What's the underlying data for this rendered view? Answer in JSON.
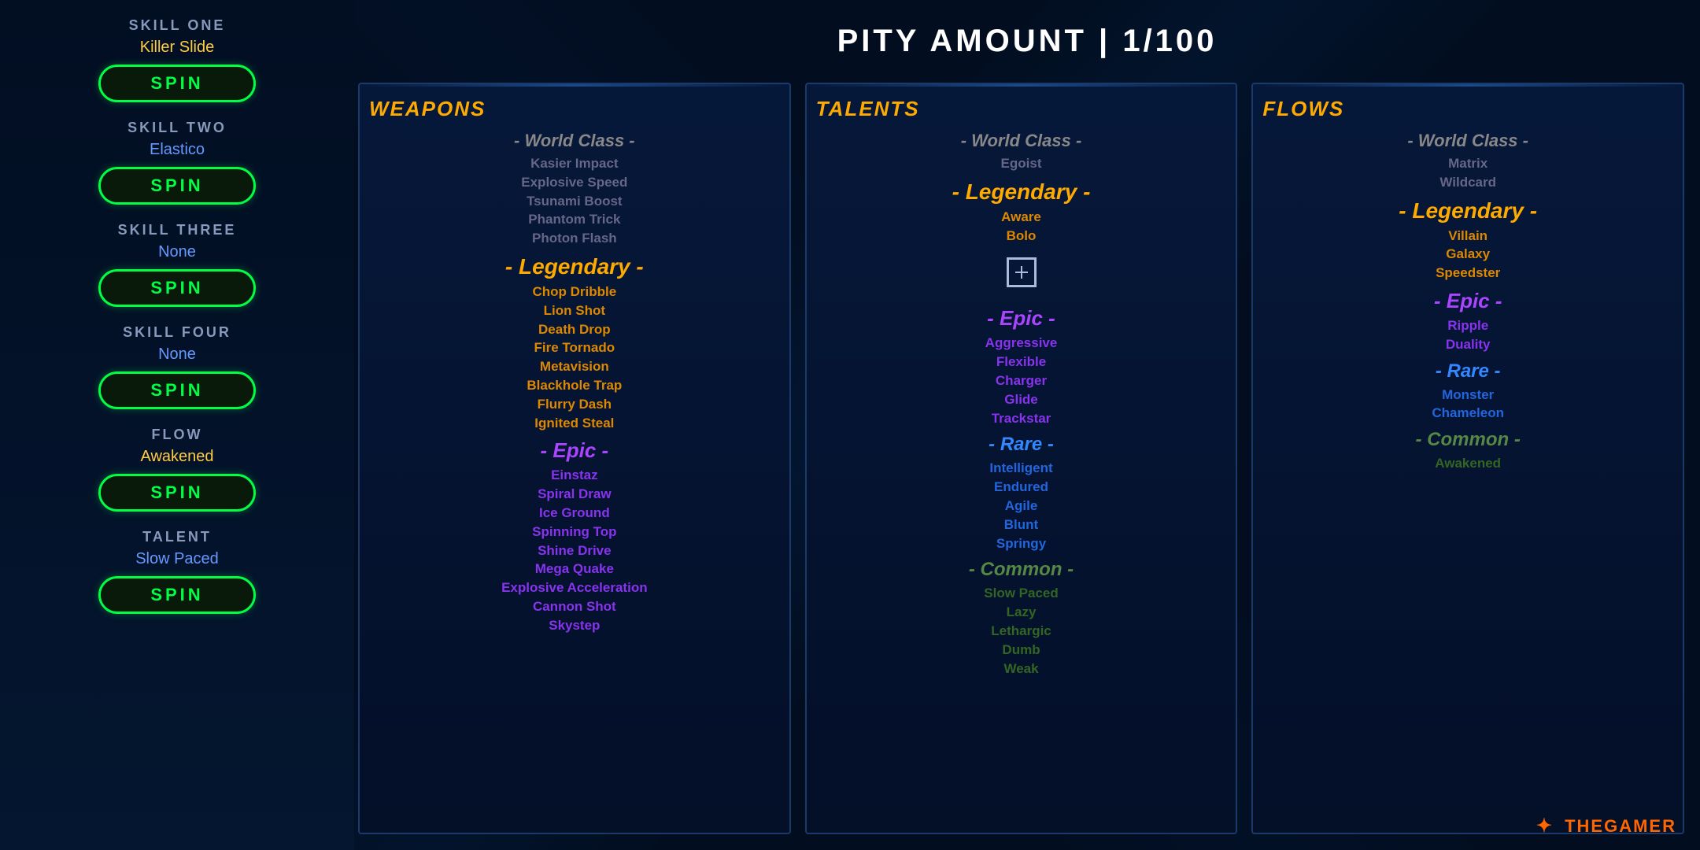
{
  "header": {
    "pity_label": "PITY AMOUNT | 1/100"
  },
  "left_panel": {
    "skills": [
      {
        "label": "SKILL ONE",
        "value": "Killer Slide",
        "value_color": "yellow",
        "btn_label": "SPIN"
      },
      {
        "label": "SKILL TWO",
        "value": "Elastico",
        "value_color": "blue",
        "btn_label": "SPIN"
      },
      {
        "label": "SKILL THREE",
        "value": "None",
        "value_color": "blue",
        "btn_label": "SPIN"
      },
      {
        "label": "SKILL FOUR",
        "value": "None",
        "value_color": "blue",
        "btn_label": "SPIN"
      },
      {
        "label": "FLOW",
        "value": "Awakened",
        "value_color": "yellow",
        "btn_label": "SPIN"
      },
      {
        "label": "TALENT",
        "value": "Slow Paced",
        "value_color": "blue",
        "btn_label": "SPIN"
      }
    ]
  },
  "weapons_panel": {
    "title": "WEAPONS",
    "tiers": [
      {
        "heading": "- World Class -",
        "class": "world-class",
        "items": [
          "Kasier Impact",
          "Explosive Speed",
          "Tsunami Boost",
          "Phantom Trick",
          "Photon Flash"
        ]
      },
      {
        "heading": "- Legendary -",
        "class": "legendary",
        "items": [
          "Chop Dribble",
          "Lion Shot",
          "Death Drop",
          "Fire Tornado",
          "Metavision",
          "Blackhole Trap",
          "Flurry Dash",
          "Ignited Steal"
        ]
      },
      {
        "heading": "- Epic -",
        "class": "epic",
        "items": [
          "Einstaz",
          "Spiral Draw",
          "Ice Ground",
          "Spinning Top",
          "Shine Drive",
          "Mega Quake",
          "Explosive Acceleration",
          "Cannon Shot",
          "Skystep"
        ]
      }
    ]
  },
  "talents_panel": {
    "title": "TALENTS",
    "tiers": [
      {
        "heading": "- World Class -",
        "class": "world-class",
        "items": [
          "Egoist"
        ]
      },
      {
        "heading": "- Legendary -",
        "class": "legendary",
        "items": [
          "Aware",
          "Bolo"
        ]
      },
      {
        "heading": "- Epic -",
        "class": "epic",
        "items": [
          "Aggressive",
          "Flexible",
          "Charger",
          "Glide",
          "Trackstar"
        ]
      },
      {
        "heading": "- Rare -",
        "class": "rare",
        "items": [
          "Intelligent",
          "Endured",
          "Agile",
          "Blunt",
          "Springy"
        ]
      },
      {
        "heading": "- Common -",
        "class": "common",
        "items": [
          "Slow Paced",
          "Lazy",
          "Lethargic",
          "Dumb",
          "Weak"
        ]
      }
    ]
  },
  "flows_panel": {
    "title": "FLOWS",
    "tiers": [
      {
        "heading": "- World Class -",
        "class": "world-class",
        "items": [
          "Matrix",
          "Wildcard"
        ]
      },
      {
        "heading": "- Legendary -",
        "class": "legendary",
        "items": [
          "Villain",
          "Galaxy",
          "Speedster"
        ]
      },
      {
        "heading": "- Epic -",
        "class": "epic",
        "items": [
          "Ripple",
          "Duality"
        ]
      },
      {
        "heading": "- Rare -",
        "class": "rare",
        "items": [
          "Monster",
          "Chameleon"
        ]
      },
      {
        "heading": "- Common -",
        "class": "common",
        "items": [
          "Awakened"
        ]
      }
    ]
  },
  "watermark": "THEGAMER"
}
